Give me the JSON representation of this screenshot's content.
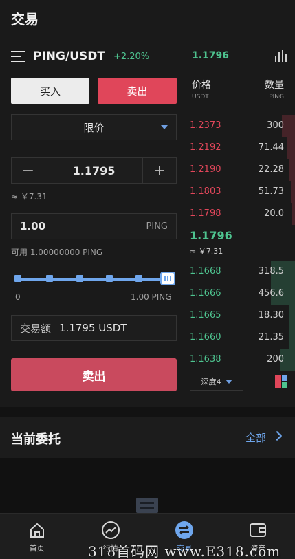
{
  "header": {
    "title": "交易"
  },
  "pair": {
    "name": "PING/USDT",
    "change": "+2.20%",
    "last_price": "1.1796"
  },
  "tabs": {
    "buy": "买入",
    "sell": "卖出"
  },
  "order_type": {
    "selected": "限价"
  },
  "price_input": {
    "value": "1.1795",
    "minus": "−",
    "plus": "+",
    "cny_approx": "≈ ￥7.31"
  },
  "quantity_input": {
    "value": "1.00",
    "unit": "PING"
  },
  "available": "可用 1.00000000 PING",
  "slider": {
    "min_label": "0",
    "max_label": "1.00 PING",
    "level_percent": 100
  },
  "total": {
    "label": "交易额",
    "value": "1.1795 USDT"
  },
  "submit": {
    "label": "卖出"
  },
  "orderbook": {
    "price_header": "价格",
    "price_unit": "USDT",
    "qty_header": "数量",
    "qty_unit": "PING",
    "asks": [
      {
        "price": "1.2373",
        "qty": "300",
        "depth": 0.12
      },
      {
        "price": "1.2192",
        "qty": "71.44",
        "depth": 0.07
      },
      {
        "price": "1.2190",
        "qty": "22.28",
        "depth": 0.05
      },
      {
        "price": "1.1803",
        "qty": "51.73",
        "depth": 0.04
      },
      {
        "price": "1.1798",
        "qty": "20.0",
        "depth": 0.03
      }
    ],
    "last": "1.1796",
    "last_cny": "≈ ￥7.31",
    "bids": [
      {
        "price": "1.1668",
        "qty": "318.5",
        "depth": 0.22
      },
      {
        "price": "1.1666",
        "qty": "456.6",
        "depth": 0.22
      },
      {
        "price": "1.1665",
        "qty": "18.30",
        "depth": 0.05
      },
      {
        "price": "1.1660",
        "qty": "21.35",
        "depth": 0.05
      },
      {
        "price": "1.1638",
        "qty": "200",
        "depth": 0.14
      }
    ],
    "depth_label": "深度4"
  },
  "orders": {
    "title": "当前委托",
    "all_label": "全部"
  },
  "nav": [
    {
      "label": "首页",
      "icon": "home-icon"
    },
    {
      "label": "行情",
      "icon": "market-trend-icon"
    },
    {
      "label": "交易",
      "icon": "trade-swap-icon"
    },
    {
      "label": "资产",
      "icon": "wallet-icon"
    }
  ],
  "watermark": "318首码网 www.E318.com",
  "colors": {
    "ask": "#e0465a",
    "bid": "#4ec38f",
    "accent": "#6fa6ec",
    "sell_button": "#c94a5e"
  }
}
